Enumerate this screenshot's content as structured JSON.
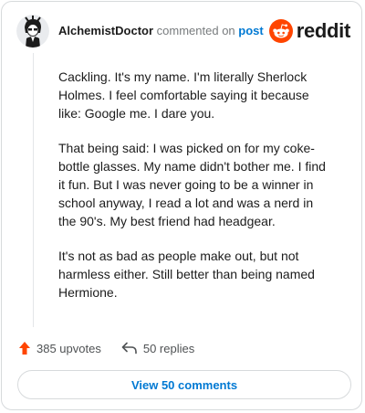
{
  "header": {
    "username": "AlchemistDoctor",
    "action_text": "commented on",
    "post_link_text": "post",
    "brand_wordmark": "reddit",
    "brand_color": "#ff4500"
  },
  "comment": {
    "paragraphs": [
      "Cackling. It's my name. I'm literally Sherlock Holmes. I feel comfortable saying it because like: Google me. I dare you.",
      "That being said: I was picked on for my coke-bottle glasses. My name didn't bother me. I find it fun. But I was never going to be a winner in school anyway, I read a lot and was a nerd in the 90's. My best friend had headgear.",
      "It's not as bad as people make out, but not harmless either. Still better than being named Hermione."
    ]
  },
  "footer": {
    "upvotes_label": "385 upvotes",
    "replies_label": "50 replies",
    "view_comments_label": "View 50 comments",
    "upvote_icon": "upvote-arrow-icon",
    "reply_icon": "reply-arrow-icon",
    "accent_color": "#0079d3"
  }
}
